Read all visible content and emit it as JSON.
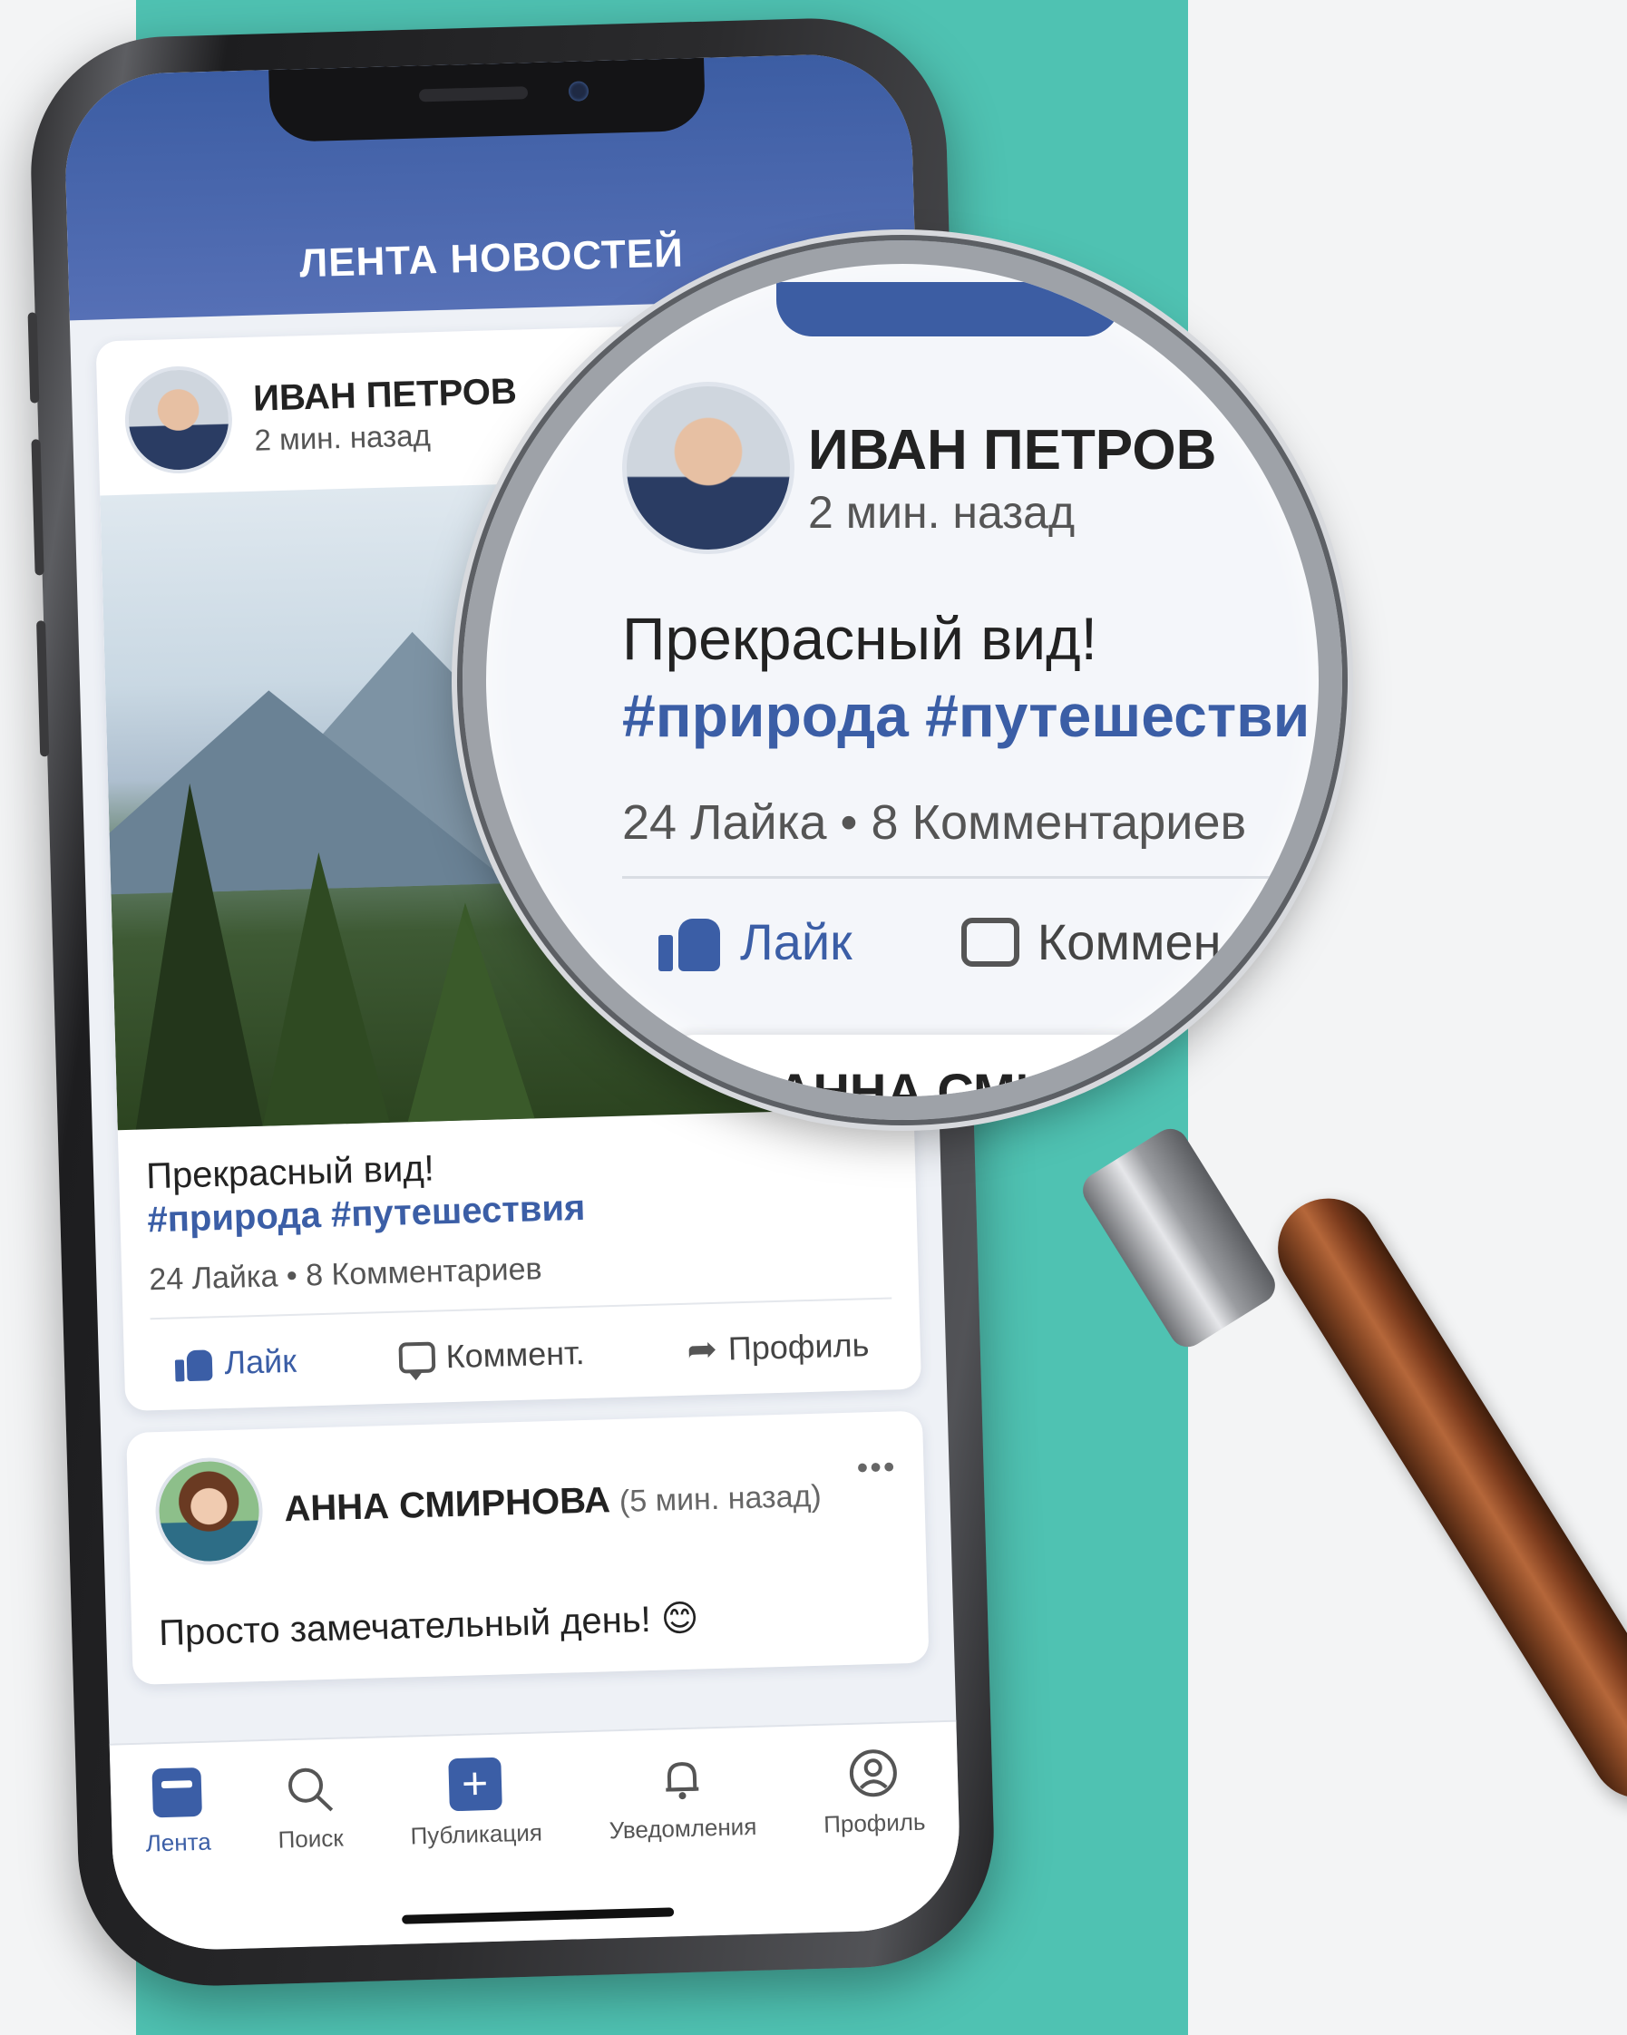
{
  "app": {
    "header_title": "ЛЕНТА НОВОСТЕЙ"
  },
  "posts": [
    {
      "author": "ИВАН ПЕТРОВ",
      "time": "2 мин. назад",
      "text": "Прекрасный вид!",
      "hashtags": "#природа #путешествия",
      "stats": "24 Лайка • 8 Комментариев",
      "actions": {
        "like": "Лайк",
        "comment": "Коммент.",
        "share": "Профиль"
      }
    },
    {
      "author": "АННА СМИРНОВА",
      "time": "(5 мин. назад)",
      "more": "•••",
      "text": "Просто замечательный день! 😊"
    }
  ],
  "magnifier": {
    "author": "ИВАН ПЕТРОВ",
    "time": "2 мин. назад",
    "text": "Прекрасный вид!",
    "hashtags": "#природа #путешестви",
    "stats": "24 Лайка • 8 Комментариев",
    "like": "Лайк",
    "comment": "Коммен",
    "next_author": "АННА СМИ"
  },
  "bottom_nav": [
    {
      "label": "Лента",
      "icon": "feed-icon",
      "active": true
    },
    {
      "label": "Поиск",
      "icon": "search-icon"
    },
    {
      "label": "Публикация",
      "icon": "plus-icon"
    },
    {
      "label": "Уведомления",
      "icon": "bell-icon"
    },
    {
      "label": "Профиль",
      "icon": "profile-icon"
    }
  ],
  "colors": {
    "background_teal": "#4fc2b2",
    "brand_blue": "#3b5ea6",
    "header_blue": "#3c5da3"
  }
}
